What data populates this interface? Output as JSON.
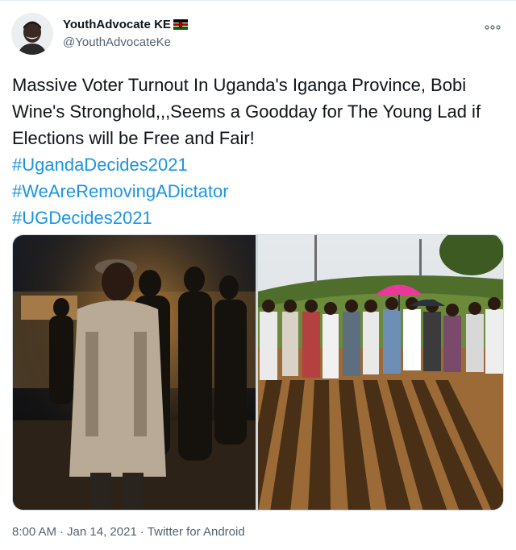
{
  "user": {
    "display_name": "YouthAdvocate KE",
    "handle": "@YouthAdvocateKe",
    "flag_icon": "kenya-flag-icon",
    "avatar_icon": "user-avatar"
  },
  "tweet": {
    "text": "Massive Voter Turnout In Uganda's Iganga Province, Bobi Wine's Stronghold,,,Seems a Goodday for The Young Lad if Elections will be Free and Fair!",
    "hashtags": [
      "#UgandaDecides2021",
      "#WeAreRemovingADictator",
      "#UGDecides2021"
    ],
    "hashtag_color": "#1b95e0"
  },
  "media": {
    "photos": [
      {
        "name": "voters-queue-night-photo"
      },
      {
        "name": "voters-queue-daylight-photo"
      }
    ]
  },
  "meta": {
    "time": "8:00 AM",
    "separator": "·",
    "date": "Jan 14, 2021",
    "source": "Twitter for Android"
  },
  "more_icon": "more-options-icon"
}
